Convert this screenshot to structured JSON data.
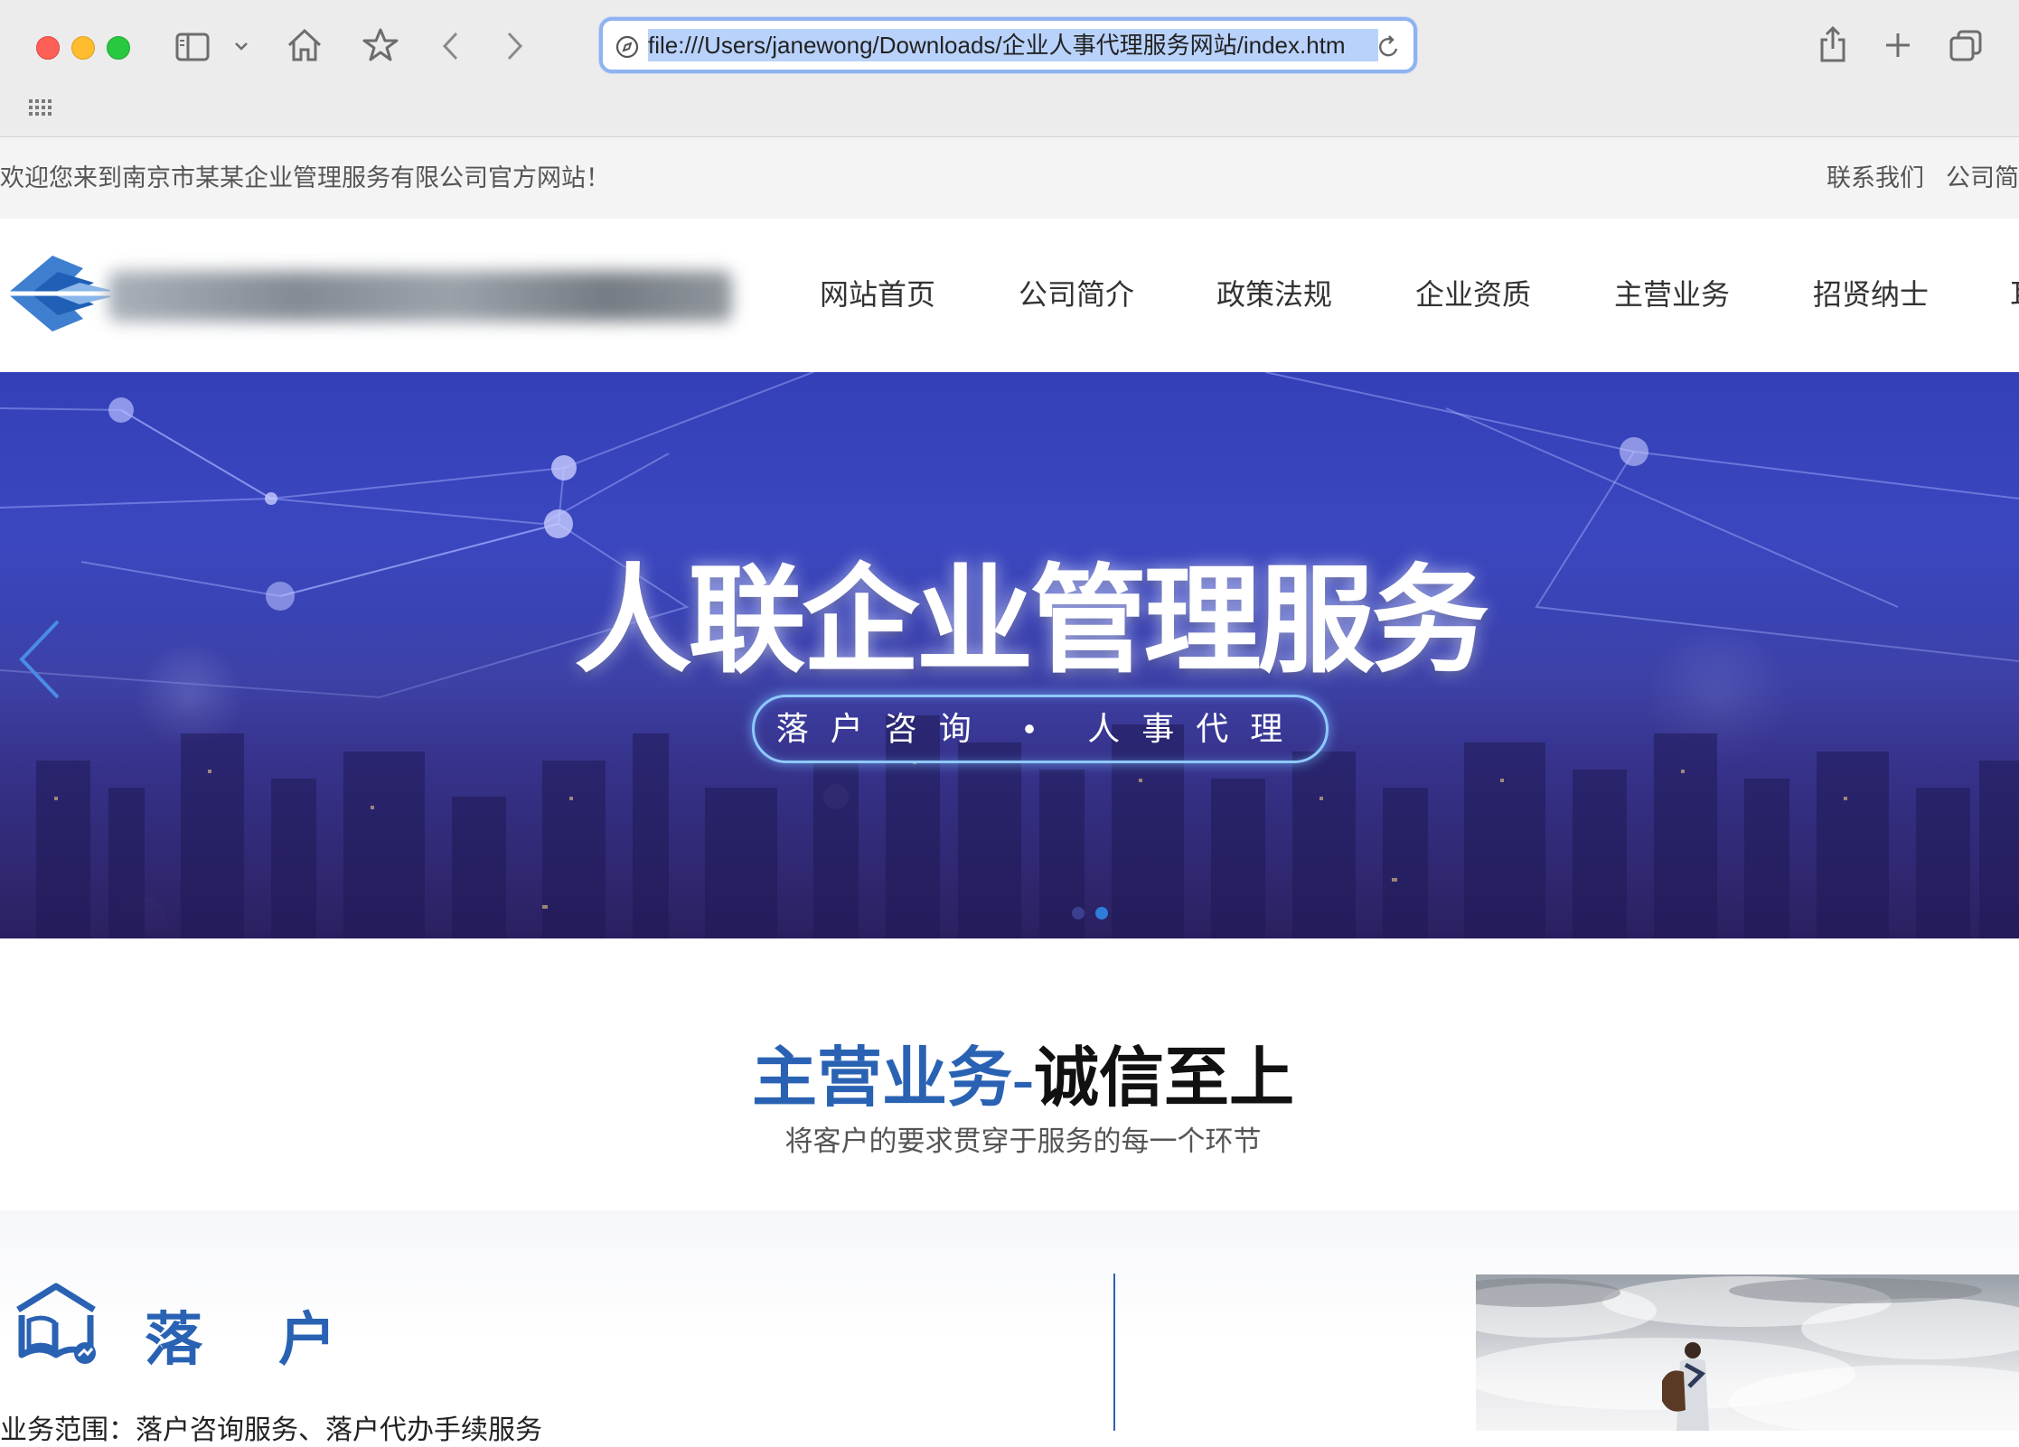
{
  "browser": {
    "url": "file:///Users/janewong/Downloads/企业人事代理服务网站/index.htm",
    "icons": [
      "sidebar-icon",
      "chevron-down-icon",
      "home-icon",
      "star-icon",
      "back-icon",
      "forward-icon",
      "share-icon",
      "new-tab-icon",
      "tab-overview-icon",
      "grid-icon"
    ],
    "accent": "#8fb2f0"
  },
  "topbar": {
    "welcome": "欢迎您来到南京市某某企业管理服务有限公司官方网站！",
    "links": [
      "联系我们",
      "公司简"
    ]
  },
  "nav": {
    "items": [
      "网站首页",
      "公司简介",
      "政策法规",
      "企业资质",
      "主营业务",
      "招贤纳士",
      "耳"
    ]
  },
  "banner": {
    "title": "人联企业管理服务",
    "subtitle": "落户咨询 • 人事代理",
    "slides": 2,
    "active_slide": 2
  },
  "section": {
    "title_blue": "主营业务-",
    "title_black": "诚信至上",
    "subtitle": "将客户的要求贯穿于服务的每一个环节"
  },
  "business": {
    "name": "落 户",
    "description": "业务范围：落户咨询服务、落户代办手续服务"
  },
  "colors": {
    "brand_blue": "#2a62b3",
    "banner_blue": "#3a44b8"
  }
}
